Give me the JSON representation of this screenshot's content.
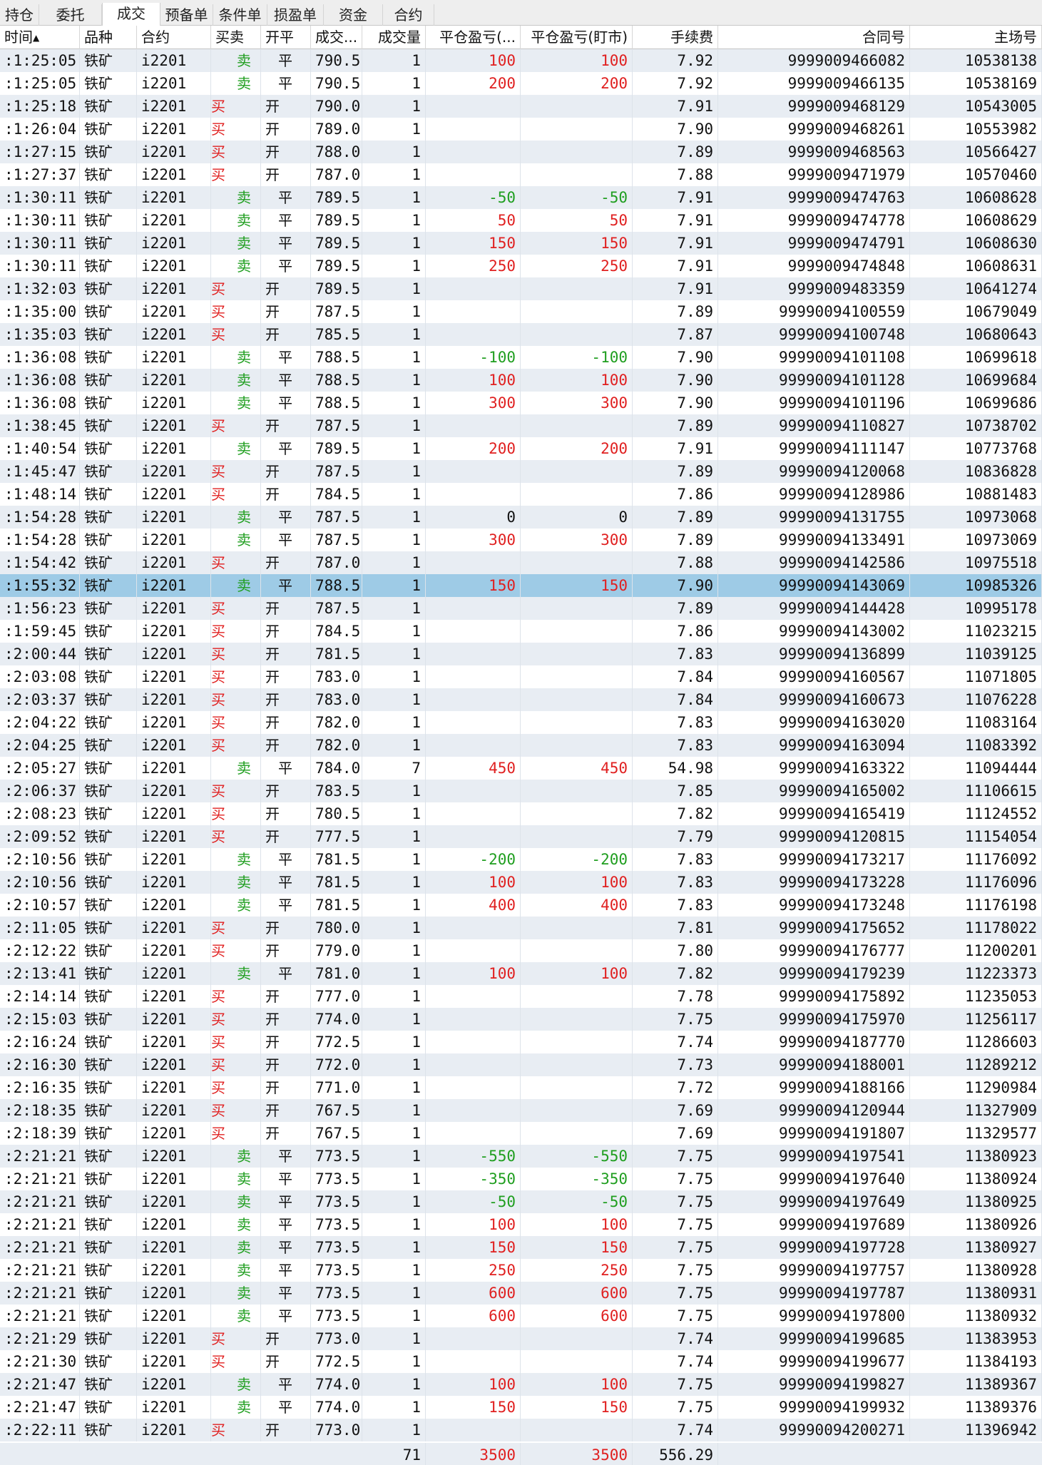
{
  "tabs": [
    {
      "label": "持仓",
      "active": false
    },
    {
      "label": "委托",
      "active": false
    },
    {
      "label": "成交",
      "active": true
    },
    {
      "label": "预备单",
      "active": false
    },
    {
      "label": "条件单",
      "active": false
    },
    {
      "label": "损盈单",
      "active": false
    },
    {
      "label": "资金",
      "active": false
    },
    {
      "label": "合约",
      "active": false
    }
  ],
  "table": {
    "columns": [
      {
        "key": "time",
        "label": "时间"
      },
      {
        "key": "product",
        "label": "品种"
      },
      {
        "key": "contract",
        "label": "合约"
      },
      {
        "key": "side",
        "label": "买卖"
      },
      {
        "key": "openclose",
        "label": "开平"
      },
      {
        "key": "price",
        "label": "成交..."
      },
      {
        "key": "qty",
        "label": "成交量"
      },
      {
        "key": "pnl_trade",
        "label": "平仓盈亏(..."
      },
      {
        "key": "pnl_mtm",
        "label": "平仓盈亏(盯市)"
      },
      {
        "key": "fee",
        "label": "手续费"
      },
      {
        "key": "order_id",
        "label": "合同号"
      },
      {
        "key": "exchange_id",
        "label": "主场号"
      }
    ],
    "sort_indicator": "▲",
    "selected_row": 23,
    "rows": [
      [
        ":1:25:05",
        "铁矿",
        "i2201",
        "卖",
        "平",
        "790.5",
        "1",
        "100",
        "100",
        "7.92",
        "9999009466082",
        "10538138"
      ],
      [
        ":1:25:05",
        "铁矿",
        "i2201",
        "卖",
        "平",
        "790.5",
        "1",
        "200",
        "200",
        "7.92",
        "9999009466135",
        "10538169"
      ],
      [
        ":1:25:18",
        "铁矿",
        "i2201",
        "买",
        "开",
        "790.0",
        "1",
        "",
        "",
        "7.91",
        "9999009468129",
        "10543005"
      ],
      [
        ":1:26:04",
        "铁矿",
        "i2201",
        "买",
        "开",
        "789.0",
        "1",
        "",
        "",
        "7.90",
        "9999009468261",
        "10553982"
      ],
      [
        ":1:27:15",
        "铁矿",
        "i2201",
        "买",
        "开",
        "788.0",
        "1",
        "",
        "",
        "7.89",
        "9999009468563",
        "10566427"
      ],
      [
        ":1:27:37",
        "铁矿",
        "i2201",
        "买",
        "开",
        "787.0",
        "1",
        "",
        "",
        "7.88",
        "9999009471979",
        "10570460"
      ],
      [
        ":1:30:11",
        "铁矿",
        "i2201",
        "卖",
        "平",
        "789.5",
        "1",
        "-50",
        "-50",
        "7.91",
        "9999009474763",
        "10608628"
      ],
      [
        ":1:30:11",
        "铁矿",
        "i2201",
        "卖",
        "平",
        "789.5",
        "1",
        "50",
        "50",
        "7.91",
        "9999009474778",
        "10608629"
      ],
      [
        ":1:30:11",
        "铁矿",
        "i2201",
        "卖",
        "平",
        "789.5",
        "1",
        "150",
        "150",
        "7.91",
        "9999009474791",
        "10608630"
      ],
      [
        ":1:30:11",
        "铁矿",
        "i2201",
        "卖",
        "平",
        "789.5",
        "1",
        "250",
        "250",
        "7.91",
        "9999009474848",
        "10608631"
      ],
      [
        ":1:32:03",
        "铁矿",
        "i2201",
        "买",
        "开",
        "789.5",
        "1",
        "",
        "",
        "7.91",
        "9999009483359",
        "10641274"
      ],
      [
        ":1:35:00",
        "铁矿",
        "i2201",
        "买",
        "开",
        "787.5",
        "1",
        "",
        "",
        "7.89",
        "99990094100559",
        "10679049"
      ],
      [
        ":1:35:03",
        "铁矿",
        "i2201",
        "买",
        "开",
        "785.5",
        "1",
        "",
        "",
        "7.87",
        "99990094100748",
        "10680643"
      ],
      [
        ":1:36:08",
        "铁矿",
        "i2201",
        "卖",
        "平",
        "788.5",
        "1",
        "-100",
        "-100",
        "7.90",
        "99990094101108",
        "10699618"
      ],
      [
        ":1:36:08",
        "铁矿",
        "i2201",
        "卖",
        "平",
        "788.5",
        "1",
        "100",
        "100",
        "7.90",
        "99990094101128",
        "10699684"
      ],
      [
        ":1:36:08",
        "铁矿",
        "i2201",
        "卖",
        "平",
        "788.5",
        "1",
        "300",
        "300",
        "7.90",
        "99990094101196",
        "10699686"
      ],
      [
        ":1:38:45",
        "铁矿",
        "i2201",
        "买",
        "开",
        "787.5",
        "1",
        "",
        "",
        "7.89",
        "99990094110827",
        "10738702"
      ],
      [
        ":1:40:54",
        "铁矿",
        "i2201",
        "卖",
        "平",
        "789.5",
        "1",
        "200",
        "200",
        "7.91",
        "99990094111147",
        "10773768"
      ],
      [
        ":1:45:47",
        "铁矿",
        "i2201",
        "买",
        "开",
        "787.5",
        "1",
        "",
        "",
        "7.89",
        "99990094120068",
        "10836828"
      ],
      [
        ":1:48:14",
        "铁矿",
        "i2201",
        "买",
        "开",
        "784.5",
        "1",
        "",
        "",
        "7.86",
        "99990094128986",
        "10881483"
      ],
      [
        ":1:54:28",
        "铁矿",
        "i2201",
        "卖",
        "平",
        "787.5",
        "1",
        "0",
        "0",
        "7.89",
        "99990094131755",
        "10973068"
      ],
      [
        ":1:54:28",
        "铁矿",
        "i2201",
        "卖",
        "平",
        "787.5",
        "1",
        "300",
        "300",
        "7.89",
        "99990094133491",
        "10973069"
      ],
      [
        ":1:54:42",
        "铁矿",
        "i2201",
        "买",
        "开",
        "787.0",
        "1",
        "",
        "",
        "7.88",
        "99990094142586",
        "10975518"
      ],
      [
        ":1:55:32",
        "铁矿",
        "i2201",
        "卖",
        "平",
        "788.5",
        "1",
        "150",
        "150",
        "7.90",
        "99990094143069",
        "10985326"
      ],
      [
        ":1:56:23",
        "铁矿",
        "i2201",
        "买",
        "开",
        "787.5",
        "1",
        "",
        "",
        "7.89",
        "99990094144428",
        "10995178"
      ],
      [
        ":1:59:45",
        "铁矿",
        "i2201",
        "买",
        "开",
        "784.5",
        "1",
        "",
        "",
        "7.86",
        "99990094143002",
        "11023215"
      ],
      [
        ":2:00:44",
        "铁矿",
        "i2201",
        "买",
        "开",
        "781.5",
        "1",
        "",
        "",
        "7.83",
        "99990094136899",
        "11039125"
      ],
      [
        ":2:03:08",
        "铁矿",
        "i2201",
        "买",
        "开",
        "783.0",
        "1",
        "",
        "",
        "7.84",
        "99990094160567",
        "11071805"
      ],
      [
        ":2:03:37",
        "铁矿",
        "i2201",
        "买",
        "开",
        "783.0",
        "1",
        "",
        "",
        "7.84",
        "99990094160673",
        "11076228"
      ],
      [
        ":2:04:22",
        "铁矿",
        "i2201",
        "买",
        "开",
        "782.0",
        "1",
        "",
        "",
        "7.83",
        "99990094163020",
        "11083164"
      ],
      [
        ":2:04:25",
        "铁矿",
        "i2201",
        "买",
        "开",
        "782.0",
        "1",
        "",
        "",
        "7.83",
        "99990094163094",
        "11083392"
      ],
      [
        ":2:05:27",
        "铁矿",
        "i2201",
        "卖",
        "平",
        "784.0",
        "7",
        "450",
        "450",
        "54.98",
        "99990094163322",
        "11094444"
      ],
      [
        ":2:06:37",
        "铁矿",
        "i2201",
        "买",
        "开",
        "783.5",
        "1",
        "",
        "",
        "7.85",
        "99990094165002",
        "11106615"
      ],
      [
        ":2:08:23",
        "铁矿",
        "i2201",
        "买",
        "开",
        "780.5",
        "1",
        "",
        "",
        "7.82",
        "99990094165419",
        "11124552"
      ],
      [
        ":2:09:52",
        "铁矿",
        "i2201",
        "买",
        "开",
        "777.5",
        "1",
        "",
        "",
        "7.79",
        "99990094120815",
        "11154054"
      ],
      [
        ":2:10:56",
        "铁矿",
        "i2201",
        "卖",
        "平",
        "781.5",
        "1",
        "-200",
        "-200",
        "7.83",
        "99990094173217",
        "11176092"
      ],
      [
        ":2:10:56",
        "铁矿",
        "i2201",
        "卖",
        "平",
        "781.5",
        "1",
        "100",
        "100",
        "7.83",
        "99990094173228",
        "11176096"
      ],
      [
        ":2:10:57",
        "铁矿",
        "i2201",
        "卖",
        "平",
        "781.5",
        "1",
        "400",
        "400",
        "7.83",
        "99990094173248",
        "11176198"
      ],
      [
        ":2:11:05",
        "铁矿",
        "i2201",
        "买",
        "开",
        "780.0",
        "1",
        "",
        "",
        "7.81",
        "99990094175652",
        "11178022"
      ],
      [
        ":2:12:22",
        "铁矿",
        "i2201",
        "买",
        "开",
        "779.0",
        "1",
        "",
        "",
        "7.80",
        "99990094176777",
        "11200201"
      ],
      [
        ":2:13:41",
        "铁矿",
        "i2201",
        "卖",
        "平",
        "781.0",
        "1",
        "100",
        "100",
        "7.82",
        "99990094179239",
        "11223373"
      ],
      [
        ":2:14:14",
        "铁矿",
        "i2201",
        "买",
        "开",
        "777.0",
        "1",
        "",
        "",
        "7.78",
        "99990094175892",
        "11235053"
      ],
      [
        ":2:15:03",
        "铁矿",
        "i2201",
        "买",
        "开",
        "774.0",
        "1",
        "",
        "",
        "7.75",
        "99990094175970",
        "11256117"
      ],
      [
        ":2:16:24",
        "铁矿",
        "i2201",
        "买",
        "开",
        "772.5",
        "1",
        "",
        "",
        "7.74",
        "99990094187770",
        "11286603"
      ],
      [
        ":2:16:30",
        "铁矿",
        "i2201",
        "买",
        "开",
        "772.0",
        "1",
        "",
        "",
        "7.73",
        "99990094188001",
        "11289212"
      ],
      [
        ":2:16:35",
        "铁矿",
        "i2201",
        "买",
        "开",
        "771.0",
        "1",
        "",
        "",
        "7.72",
        "99990094188166",
        "11290984"
      ],
      [
        ":2:18:35",
        "铁矿",
        "i2201",
        "买",
        "开",
        "767.5",
        "1",
        "",
        "",
        "7.69",
        "99990094120944",
        "11327909"
      ],
      [
        ":2:18:39",
        "铁矿",
        "i2201",
        "买",
        "开",
        "767.5",
        "1",
        "",
        "",
        "7.69",
        "99990094191807",
        "11329577"
      ],
      [
        ":2:21:21",
        "铁矿",
        "i2201",
        "卖",
        "平",
        "773.5",
        "1",
        "-550",
        "-550",
        "7.75",
        "99990094197541",
        "11380923"
      ],
      [
        ":2:21:21",
        "铁矿",
        "i2201",
        "卖",
        "平",
        "773.5",
        "1",
        "-350",
        "-350",
        "7.75",
        "99990094197640",
        "11380924"
      ],
      [
        ":2:21:21",
        "铁矿",
        "i2201",
        "卖",
        "平",
        "773.5",
        "1",
        "-50",
        "-50",
        "7.75",
        "99990094197649",
        "11380925"
      ],
      [
        ":2:21:21",
        "铁矿",
        "i2201",
        "卖",
        "平",
        "773.5",
        "1",
        "100",
        "100",
        "7.75",
        "99990094197689",
        "11380926"
      ],
      [
        ":2:21:21",
        "铁矿",
        "i2201",
        "卖",
        "平",
        "773.5",
        "1",
        "150",
        "150",
        "7.75",
        "99990094197728",
        "11380927"
      ],
      [
        ":2:21:21",
        "铁矿",
        "i2201",
        "卖",
        "平",
        "773.5",
        "1",
        "250",
        "250",
        "7.75",
        "99990094197757",
        "11380928"
      ],
      [
        ":2:21:21",
        "铁矿",
        "i2201",
        "卖",
        "平",
        "773.5",
        "1",
        "600",
        "600",
        "7.75",
        "99990094197787",
        "11380931"
      ],
      [
        ":2:21:21",
        "铁矿",
        "i2201",
        "卖",
        "平",
        "773.5",
        "1",
        "600",
        "600",
        "7.75",
        "99990094197800",
        "11380932"
      ],
      [
        ":2:21:29",
        "铁矿",
        "i2201",
        "买",
        "开",
        "773.0",
        "1",
        "",
        "",
        "7.74",
        "99990094199685",
        "11383953"
      ],
      [
        ":2:21:30",
        "铁矿",
        "i2201",
        "买",
        "开",
        "772.5",
        "1",
        "",
        "",
        "7.74",
        "99990094199677",
        "11384193"
      ],
      [
        ":2:21:47",
        "铁矿",
        "i2201",
        "卖",
        "平",
        "774.0",
        "1",
        "100",
        "100",
        "7.75",
        "99990094199827",
        "11389367"
      ],
      [
        ":2:21:47",
        "铁矿",
        "i2201",
        "卖",
        "平",
        "774.0",
        "1",
        "150",
        "150",
        "7.75",
        "99990094199932",
        "11389376"
      ],
      [
        ":2:22:11",
        "铁矿",
        "i2201",
        "买",
        "开",
        "773.0",
        "1",
        "",
        "",
        "7.74",
        "99990094200271",
        "11396942"
      ]
    ],
    "totals": {
      "qty": "71",
      "pnl_trade": "3500",
      "pnl_mtm": "3500",
      "fee": "556.29"
    }
  },
  "colors": {
    "buy": "#e02020",
    "sell": "#1f9e1f",
    "row_alt": "#e8edf3",
    "row_selected": "#9ecbe6"
  }
}
